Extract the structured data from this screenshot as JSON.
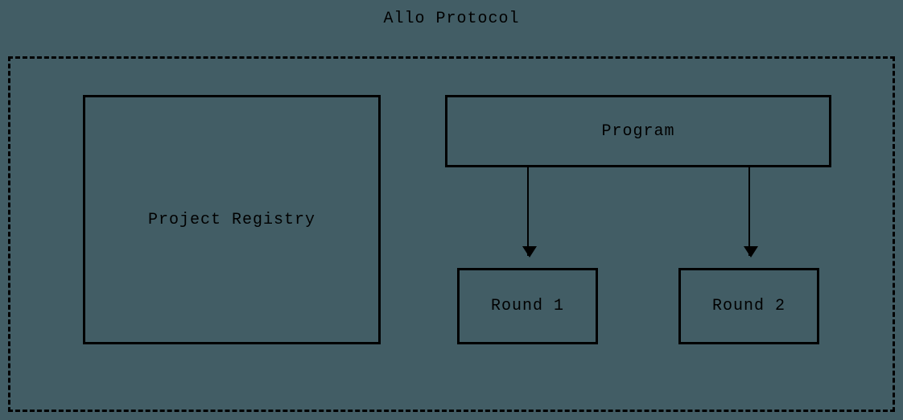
{
  "title": "Allo Protocol",
  "boxes": {
    "project_registry": "Project Registry",
    "program": "Program",
    "round1": "Round 1",
    "round2": "Round 2"
  }
}
